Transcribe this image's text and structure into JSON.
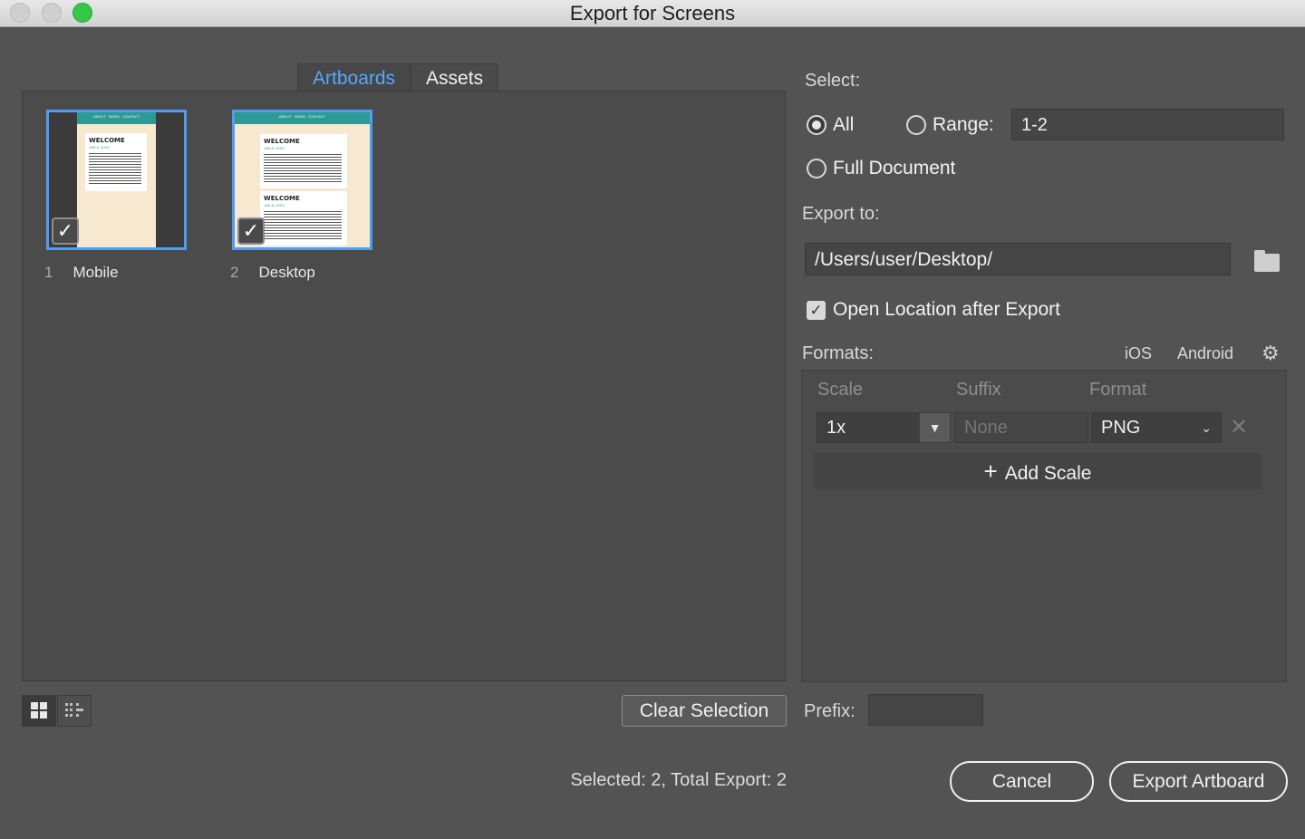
{
  "window": {
    "title": "Export for Screens"
  },
  "tabs": [
    {
      "label": "Artboards",
      "active": true
    },
    {
      "label": "Assets",
      "active": false
    }
  ],
  "artboards": [
    {
      "number": "1",
      "name": "Mobile",
      "selected": true,
      "nav_text": "ABOUT   NEWS   CONTACT",
      "heading": "WELCOME",
      "subheading": "JAN 8, 20XX"
    },
    {
      "number": "2",
      "name": "Desktop",
      "selected": true,
      "nav_text": "ABOUT   NEWS   CONTACT",
      "heading": "WELCOME",
      "subheading": "JAN 8, 20XX"
    }
  ],
  "clear_selection": "Clear Selection",
  "status": "Selected: 2, Total Export: 2",
  "select": {
    "label": "Select:",
    "all": "All",
    "range": "Range:",
    "range_value": "1-2",
    "full_document": "Full Document",
    "selected_option": "All"
  },
  "export_to": {
    "label": "Export to:",
    "path": "/Users/user/Desktop/"
  },
  "open_location": {
    "label": "Open Location after Export",
    "checked": true
  },
  "formats": {
    "label": "Formats:",
    "ios": "iOS",
    "android": "Android",
    "columns": {
      "scale": "Scale",
      "suffix": "Suffix",
      "format": "Format"
    },
    "row": {
      "scale": "1x",
      "suffix_placeholder": "None",
      "format": "PNG"
    },
    "add_scale": "Add Scale"
  },
  "prefix": {
    "label": "Prefix:",
    "value": ""
  },
  "buttons": {
    "cancel": "Cancel",
    "export": "Export Artboard"
  },
  "colors": {
    "background": "#535353",
    "accent": "#4f9cf0",
    "tab_active_text": "#56a8ff",
    "thumbnail_header": "#2d9a93",
    "thumbnail_page": "#f6e9cf"
  }
}
